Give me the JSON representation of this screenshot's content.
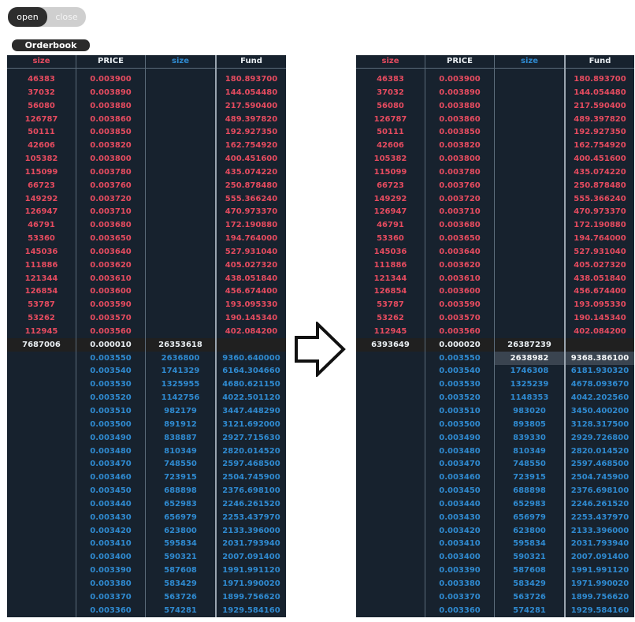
{
  "toggle": {
    "open_label": "open",
    "close_label": "close",
    "active": "open"
  },
  "orderbook_label": "Orderbook",
  "headers": {
    "ask_size": "size",
    "price": "PRICE",
    "bid_size": "size",
    "fund": "Fund"
  },
  "colors": {
    "ask": "#e54b5f",
    "bid": "#2f8ad0",
    "panel": "#17222e"
  },
  "asks_sizes": [
    "46383",
    "37032",
    "56080",
    "126787",
    "50111",
    "42606",
    "105382",
    "115099",
    "66723",
    "149292",
    "126947",
    "46791",
    "53360",
    "145036",
    "111886",
    "121344",
    "126854",
    "53787",
    "53262",
    "112945"
  ],
  "asks_prices": [
    "0.003900",
    "0.003890",
    "0.003880",
    "0.003860",
    "0.003850",
    "0.003820",
    "0.003800",
    "0.003780",
    "0.003760",
    "0.003720",
    "0.003710",
    "0.003680",
    "0.003650",
    "0.003640",
    "0.003620",
    "0.003610",
    "0.003600",
    "0.003590",
    "0.003570",
    "0.003560"
  ],
  "asks_funds": [
    "180.893700",
    "144.054480",
    "217.590400",
    "489.397820",
    "192.927350",
    "162.754920",
    "400.451600",
    "435.074220",
    "250.878480",
    "555.366240",
    "470.973370",
    "172.190880",
    "194.764000",
    "527.931040",
    "405.027320",
    "438.051840",
    "456.674400",
    "193.095330",
    "190.145340",
    "402.084200"
  ],
  "bids_prices": [
    "0.003550",
    "0.003540",
    "0.003530",
    "0.003520",
    "0.003510",
    "0.003500",
    "0.003490",
    "0.003480",
    "0.003470",
    "0.003460",
    "0.003450",
    "0.003440",
    "0.003430",
    "0.003420",
    "0.003410",
    "0.003400",
    "0.003390",
    "0.003380",
    "0.003370",
    "0.003360"
  ],
  "left": {
    "mid": {
      "size": "7687006",
      "price": "0.000010",
      "bid": "26353618"
    },
    "bid_sizes": [
      "2636800",
      "1741329",
      "1325955",
      "1142756",
      "982179",
      "891912",
      "838887",
      "810349",
      "748550",
      "723915",
      "688898",
      "652983",
      "656979",
      "623800",
      "595834",
      "590321",
      "587608",
      "583429",
      "563726",
      "574281"
    ],
    "bid_funds": [
      "9360.640000",
      "6164.304660",
      "4680.621150",
      "4022.501120",
      "3447.448290",
      "3121.692000",
      "2927.715630",
      "2820.014520",
      "2597.468500",
      "2504.745900",
      "2376.698100",
      "2246.261520",
      "2253.437970",
      "2133.396000",
      "2031.793940",
      "2007.091400",
      "1991.991120",
      "1971.990020",
      "1899.756620",
      "1929.584160"
    ]
  },
  "right": {
    "mid": {
      "size": "6393649",
      "price": "0.000020",
      "bid": "26387239"
    },
    "bid_sizes": [
      "2638982",
      "1746308",
      "1325239",
      "1148353",
      "983020",
      "893805",
      "839330",
      "810349",
      "748550",
      "723915",
      "688898",
      "652983",
      "656979",
      "623800",
      "595834",
      "590321",
      "587608",
      "583429",
      "563726",
      "574281"
    ],
    "bid_funds": [
      "9368.386100",
      "6181.930320",
      "4678.093670",
      "4042.202560",
      "3450.400200",
      "3128.317500",
      "2929.726800",
      "2820.014520",
      "2597.468500",
      "2504.745900",
      "2376.698100",
      "2246.261520",
      "2253.437970",
      "2133.396000",
      "2031.793940",
      "2007.091400",
      "1991.991120",
      "1971.990020",
      "1899.756620",
      "1929.584160"
    ]
  }
}
